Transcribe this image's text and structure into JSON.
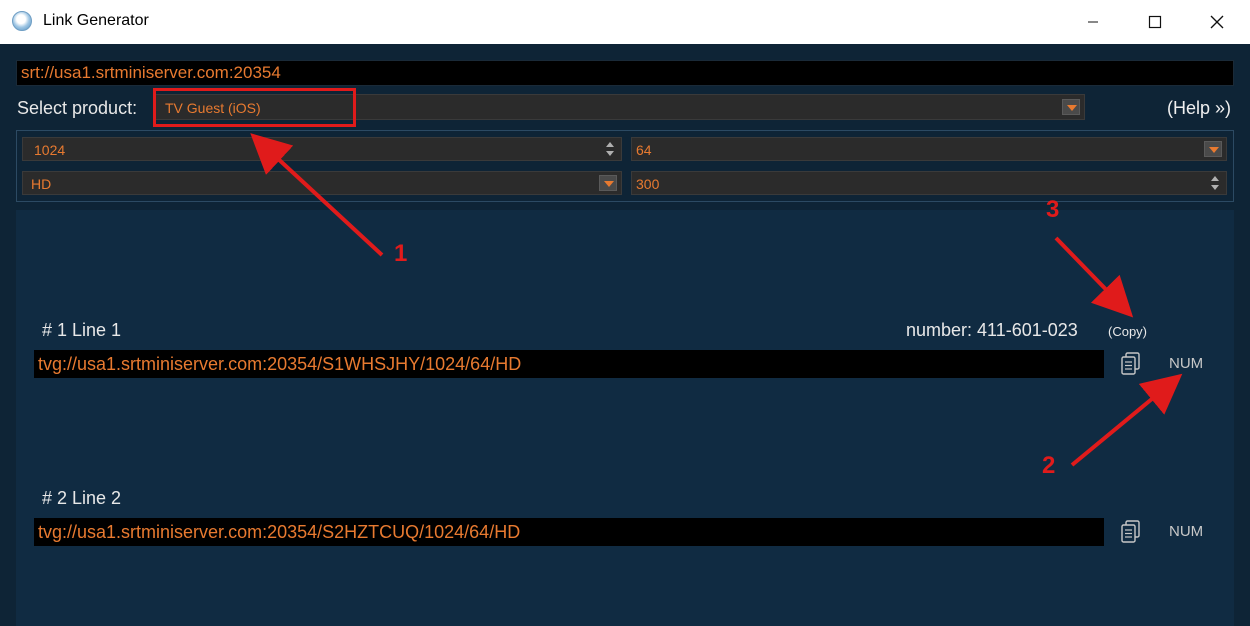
{
  "window": {
    "title": "Link Generator",
    "controls": {
      "minimize": "minimize",
      "maximize": "maximize",
      "close": "close"
    }
  },
  "server": {
    "address": "srt://usa1.srtminiserver.com:20354"
  },
  "product": {
    "label": "Select product:",
    "selected": "TV Guest (iOS)"
  },
  "help": {
    "label": "(Help »)"
  },
  "params": {
    "field1": "1024",
    "field2": "64",
    "field3": "HD",
    "field4": "300"
  },
  "lines": [
    {
      "label": "# 1   Line 1",
      "url": "tvg://usa1.srtminiserver.com:20354/S1WHSJHY/1024/64/HD",
      "number_text": "number: 411-601-023",
      "copy_label": "(Copy)",
      "num_label": "NUM"
    },
    {
      "label": "# 2   Line 2",
      "url": "tvg://usa1.srtminiserver.com:20354/S2HZTCUQ/1024/64/HD",
      "num_label": "NUM"
    }
  ],
  "annotations": {
    "one": "1",
    "two": "2",
    "three": "3",
    "color": "#e01b1b"
  },
  "colors": {
    "accent": "#e87a30",
    "background": "#0e2436",
    "panel": "#102b42"
  }
}
